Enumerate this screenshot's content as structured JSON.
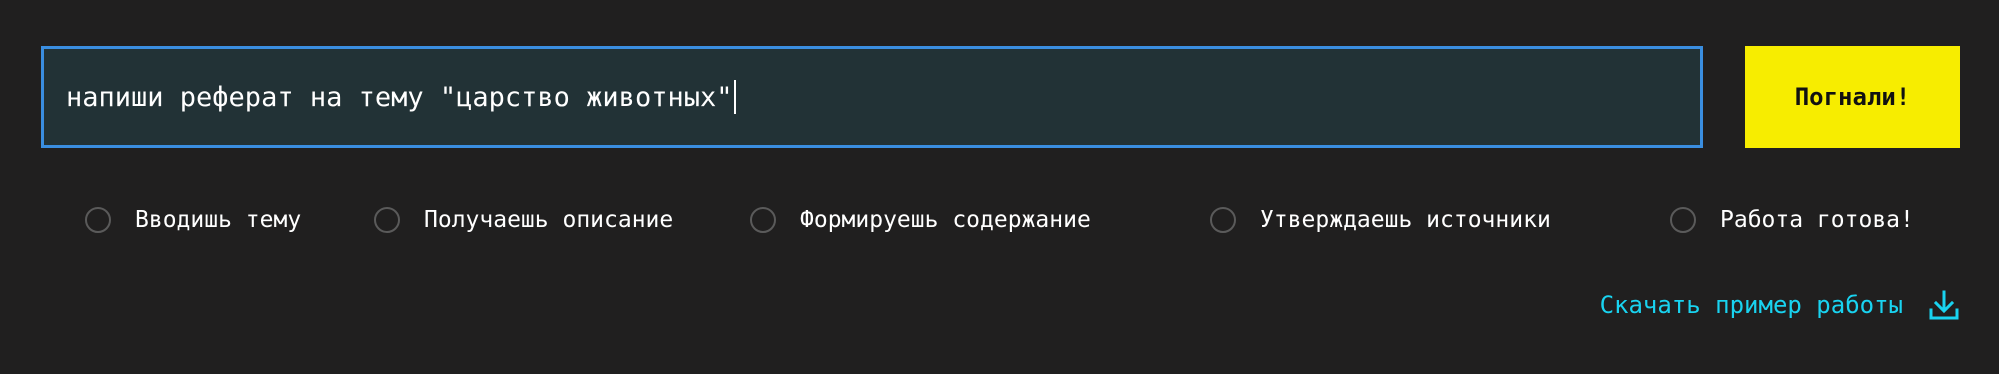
{
  "search": {
    "value": "напиши реферат на тему \"царство животных\""
  },
  "submit_button": {
    "label": "Погнали!"
  },
  "steps": [
    {
      "label": "Вводишь тему"
    },
    {
      "label": "Получаешь описание"
    },
    {
      "label": "Формируешь содержание"
    },
    {
      "label": "Утверждаешь источники"
    },
    {
      "label": "Работа готова!"
    }
  ],
  "download": {
    "label": "Скачать пример работы",
    "icon": "download-icon"
  },
  "colors": {
    "background": "#201f1f",
    "input_border": "#3a8ee0",
    "input_background": "#223236",
    "button": "#f7ed00",
    "link": "#19d3f0"
  }
}
